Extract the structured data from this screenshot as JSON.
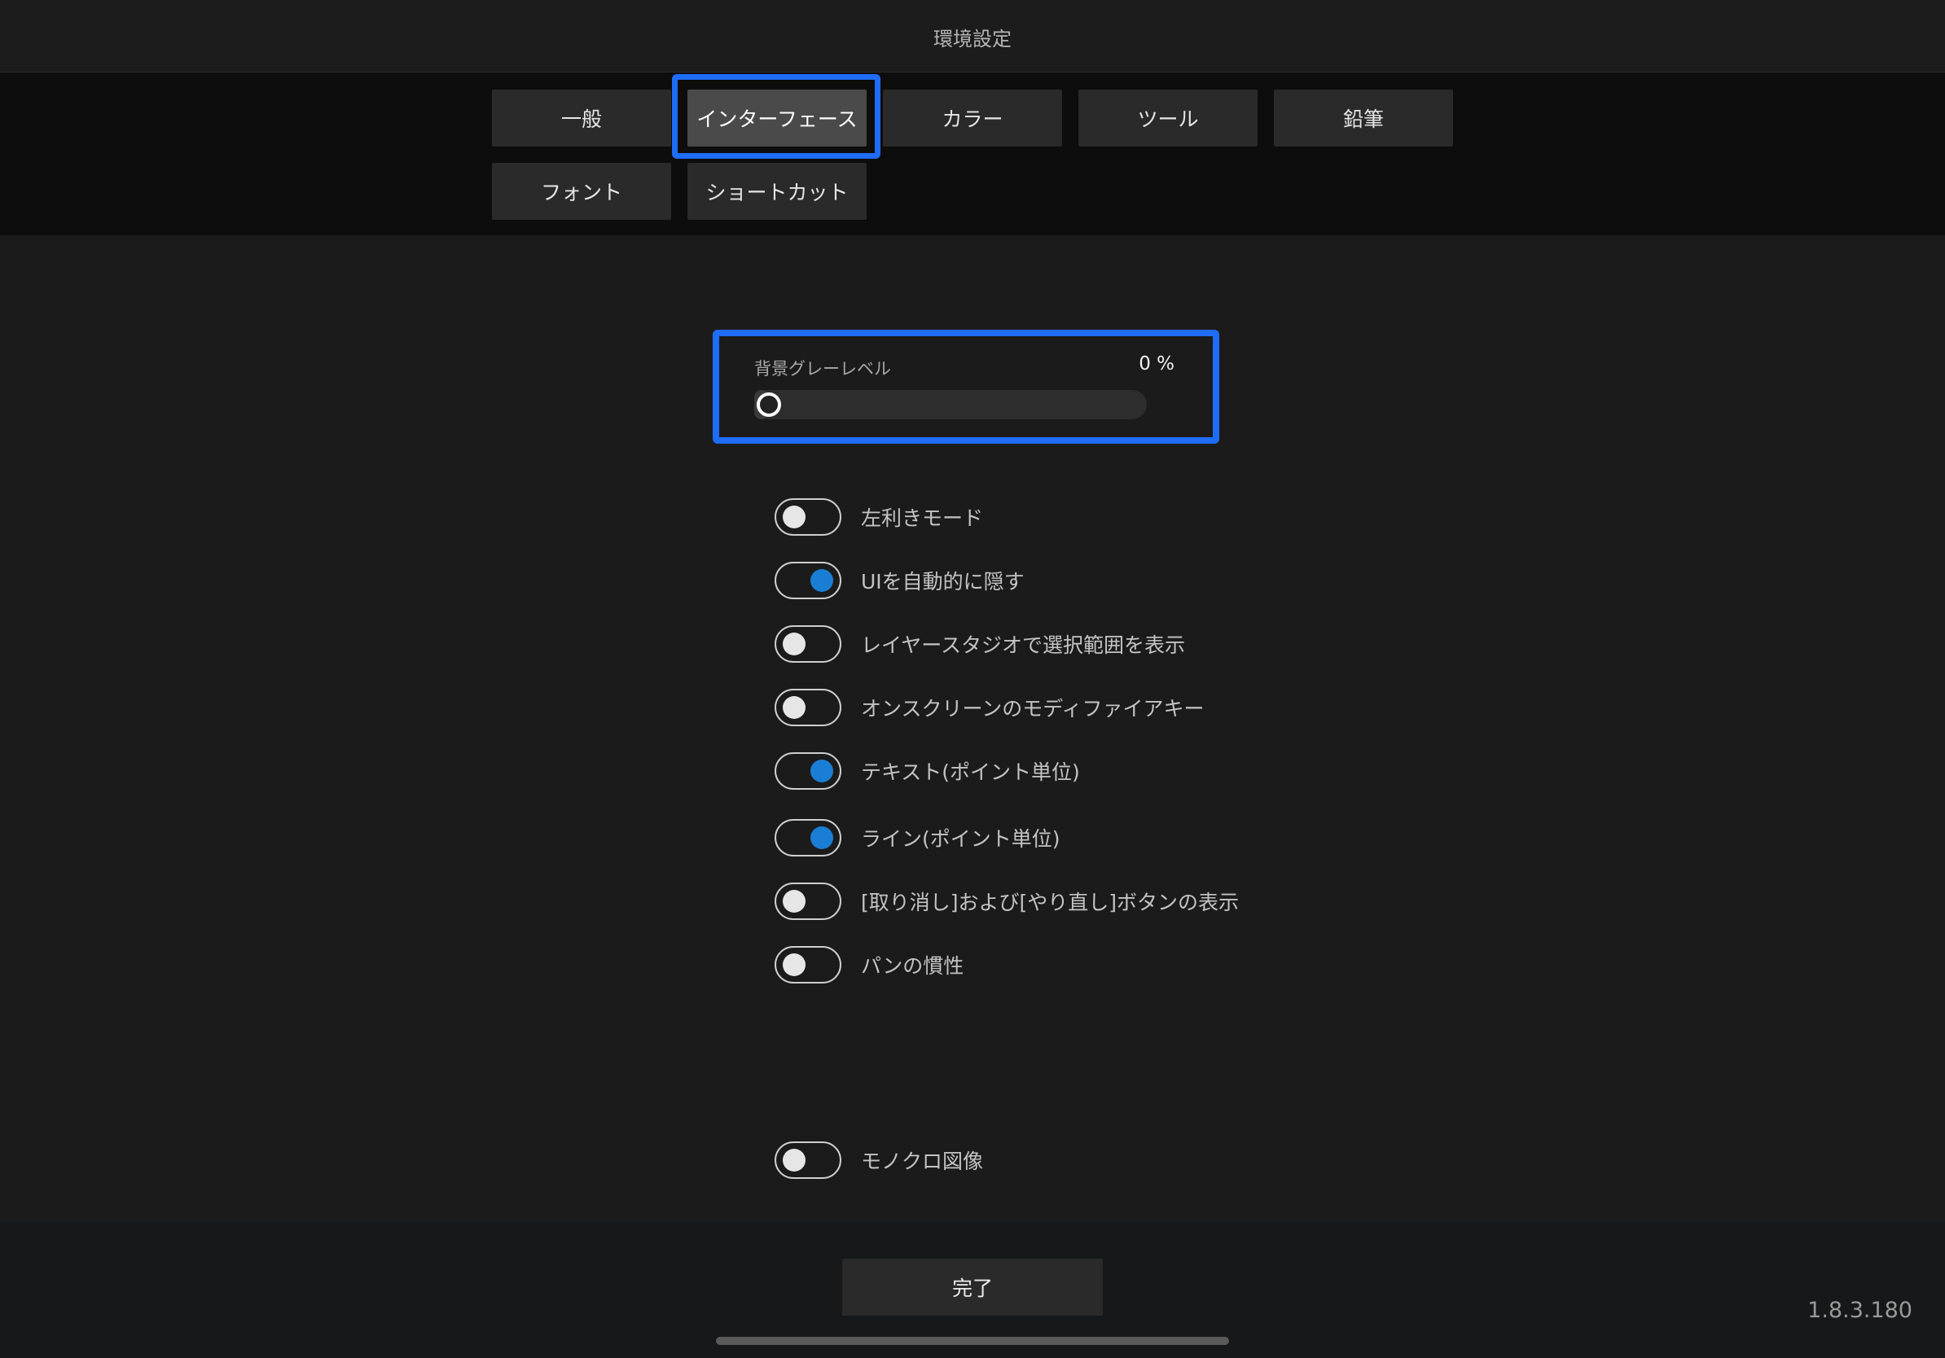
{
  "header": {
    "title": "環境設定"
  },
  "tabs": [
    {
      "label": "一般",
      "active": false
    },
    {
      "label": "インターフェース",
      "active": true
    },
    {
      "label": "カラー",
      "active": false
    },
    {
      "label": "ツール",
      "active": false
    },
    {
      "label": "鉛筆",
      "active": false
    },
    {
      "label": "フォント",
      "active": false
    },
    {
      "label": "ショートカット",
      "active": false
    }
  ],
  "slider": {
    "label": "背景グレーレベル",
    "value_text": "0 %",
    "value": 0
  },
  "toggles": [
    {
      "label": "左利きモード",
      "on": false
    },
    {
      "label": "UIを自動的に隠す",
      "on": true
    },
    {
      "label": "レイヤースタジオで選択範囲を表示",
      "on": false
    },
    {
      "label": "オンスクリーンのモディファイアキー",
      "on": false
    },
    {
      "label": "テキスト(ポイント単位)",
      "on": true
    },
    {
      "label": "ライン(ポイント単位)",
      "on": true
    },
    {
      "label": "[取り消し]および[やり直し]ボタンの表示",
      "on": false
    },
    {
      "label": "パンの慣性",
      "on": false
    },
    {
      "label": "モノクロ図像",
      "on": false
    }
  ],
  "footer": {
    "done_label": "完了",
    "version": "1.8.3.180"
  },
  "colors": {
    "highlight": "#1f6cf5",
    "toggle_on": "#1a7fd4",
    "background": "#1b1b1c"
  }
}
